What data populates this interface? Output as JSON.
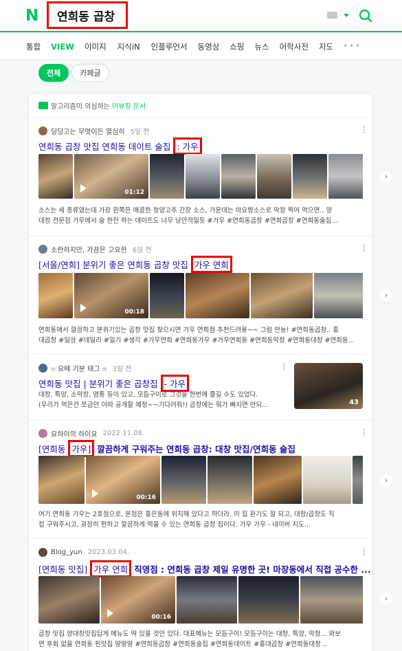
{
  "header": {
    "logo": "N",
    "search_query": "연희동 곱창"
  },
  "tabs": [
    {
      "label": "통합",
      "active": false
    },
    {
      "label": "VIEW",
      "active": true
    },
    {
      "label": "이미지",
      "active": false
    },
    {
      "label": "지식iN",
      "active": false
    },
    {
      "label": "인플루언서",
      "active": false
    },
    {
      "label": "동영상",
      "active": false
    },
    {
      "label": "쇼핑",
      "active": false
    },
    {
      "label": "뉴스",
      "active": false
    },
    {
      "label": "어학사전",
      "active": false
    },
    {
      "label": "지도",
      "active": false
    }
  ],
  "more_label": "•••",
  "chips": [
    {
      "label": "전체",
      "active": true
    },
    {
      "label": "카페글",
      "active": false
    }
  ],
  "notice": {
    "text": "알고리즘이 의심하는",
    "link": "어뷰징 문서"
  },
  "posts": [
    {
      "author": "딩당고는 무엇이든 열심히",
      "date": "5일 전",
      "title_pre": "연희동 곱창 맛집 연희동 데이트 술집",
      "title_hl": ": 가우",
      "title_post": "",
      "video_duration": "01:12",
      "desc1": "소스는 세 종류였는데 가장 왼쪽은 매콤한 청양고추 간장 소스, 가운데는 마요향소스로 막창 찍어 먹으면.. 양",
      "desc2": "대창 전문점 가우에서 술 한잔 하는 데이트도 너무 낭만적일듯 #가우 #연희동곱창 #연희곱창 #연희동술집..."
    },
    {
      "author": "소란하지만, 가끔은 고요한",
      "date": "6일 전",
      "title_pre": "[서울/연희] 분위기 좋은 연희동 곱창 맛집",
      "title_hl": "가우 연희",
      "title_post": "",
      "video_duration": "00:18",
      "desc1": "연희동에서 깔끔하고 분위기있는 곱창 맛집 찾으시면 가우 연희점 추천드려용~~ 그럼 안뇽! #연희동곱창.. 홍",
      "desc2": "대곱창 #일상 #데일리 #일기 #생각 #가우연희 #연희동가우 #가우연희동 #연희동막창 #연희동대창 #연희동..."
    },
    {
      "author": "ෆ 요떼 기분 태그 ෆ",
      "date": "3일 전",
      "title_pre": "연희동 맛집 | 분위기 좋은 곱창집",
      "title_hl": "- 가우",
      "title_post": "",
      "side_count": "43",
      "desc1": "대창, 특양, 소막창, 염통 등이 있고, 모듬구이로 그것을 한번에 즐길 수도 있었다.",
      "desc2": "(우리가 먹은건 쪼금만 이따 공개할 예정~~기다려줘!) 곱창에는 뭐가 빠지면 안되..."
    },
    {
      "author": "요하이의 하이요",
      "date": "2022.11.08.",
      "title_pre": "[연희동",
      "title_hl": "가우]",
      "title_post": " 깔끔하게 구워주는 연희동 곱창: 대창 맛집/연희동 술집",
      "video_duration": "00:16",
      "desc1": "여기 연희동 가우는 2호점으로, 본점은 홍은동에 위치해 있다고 하더라. 이 집 환기도 잘 되고, 대창/곱창도 직",
      "desc2": "접 구워주시고, 굉장히 편하고 깔끔하게 먹을 수 있는 연희동 곱창 집이다. 가우 가우 - 네이버 지도..."
    },
    {
      "author": "Blog_yun",
      "date": "2023.03.04.",
      "title_pre": "[연희동 맛집]",
      "title_hl": "가우 연희",
      "title_post": " 직영점 : 연희동 곱창 제일 유명한 곳! 마장동에서 직접 공수한 ...",
      "video_duration": "00:16",
      "desc1": "곱창 맛집 양대창맛집답게 메뉴도 딱 있을 것만 있다. 대표메뉴는 모듬구이! 모듬구이는 대창, 특양, 막창... 와보",
      "desc2": "면 후회 없을 연희동 핀맛집 땅땅땅 #연희동곱창 #연희동술집 #연희동데이트 #홍대곱창 #연희동대창..."
    }
  ],
  "colors": {
    "accent": "#03c75a",
    "highlight_box": "#ee0000",
    "title_link": "#1a0dab"
  },
  "icons": [
    "search-icon",
    "keyboard-icon",
    "dropdown-icon",
    "play-icon",
    "kebab-icon",
    "next-arrow-icon"
  ]
}
